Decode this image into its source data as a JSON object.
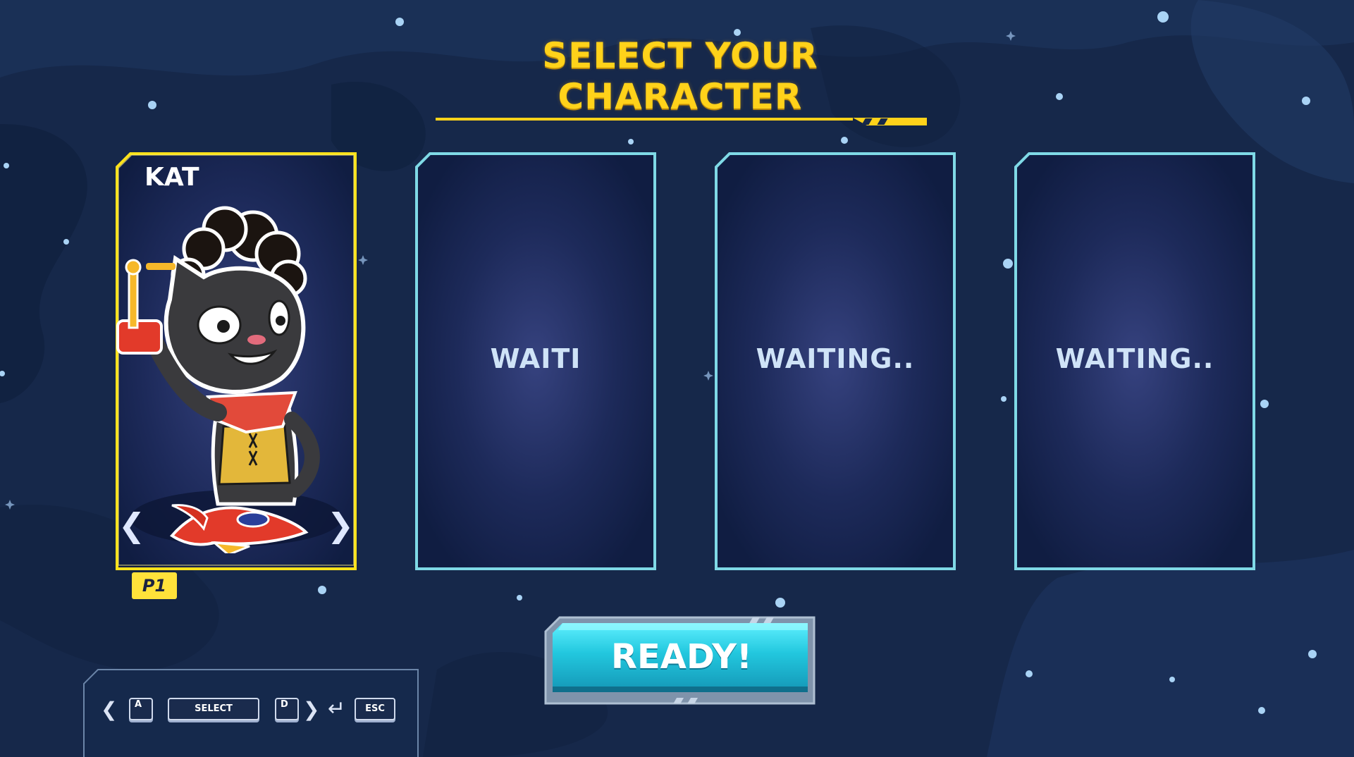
{
  "screen": {
    "title": "SELECT YOUR CHARACTER"
  },
  "slots": [
    {
      "player_badge": "P1",
      "character_name": "KAT",
      "state": "selecting"
    },
    {
      "status_text": "WAITI",
      "state": "waiting"
    },
    {
      "status_text": "WAITING..",
      "state": "waiting"
    },
    {
      "status_text": "WAITING..",
      "state": "waiting"
    }
  ],
  "carousel": {
    "prev_icon": "chevron-left-icon",
    "next_icon": "chevron-right-icon"
  },
  "ready_button": {
    "label": "READY!"
  },
  "controls": {
    "left_key": "A",
    "select_key": "SELECT",
    "right_key": "D",
    "enter_icon": "enter-icon",
    "escape_key": "ESC"
  },
  "colors": {
    "background": "#16284a",
    "title": "#ffd21a",
    "selected_frame": "#ffe21a",
    "waiting_frame": "#7fd9e6",
    "ready_button": "#21c4dc"
  }
}
